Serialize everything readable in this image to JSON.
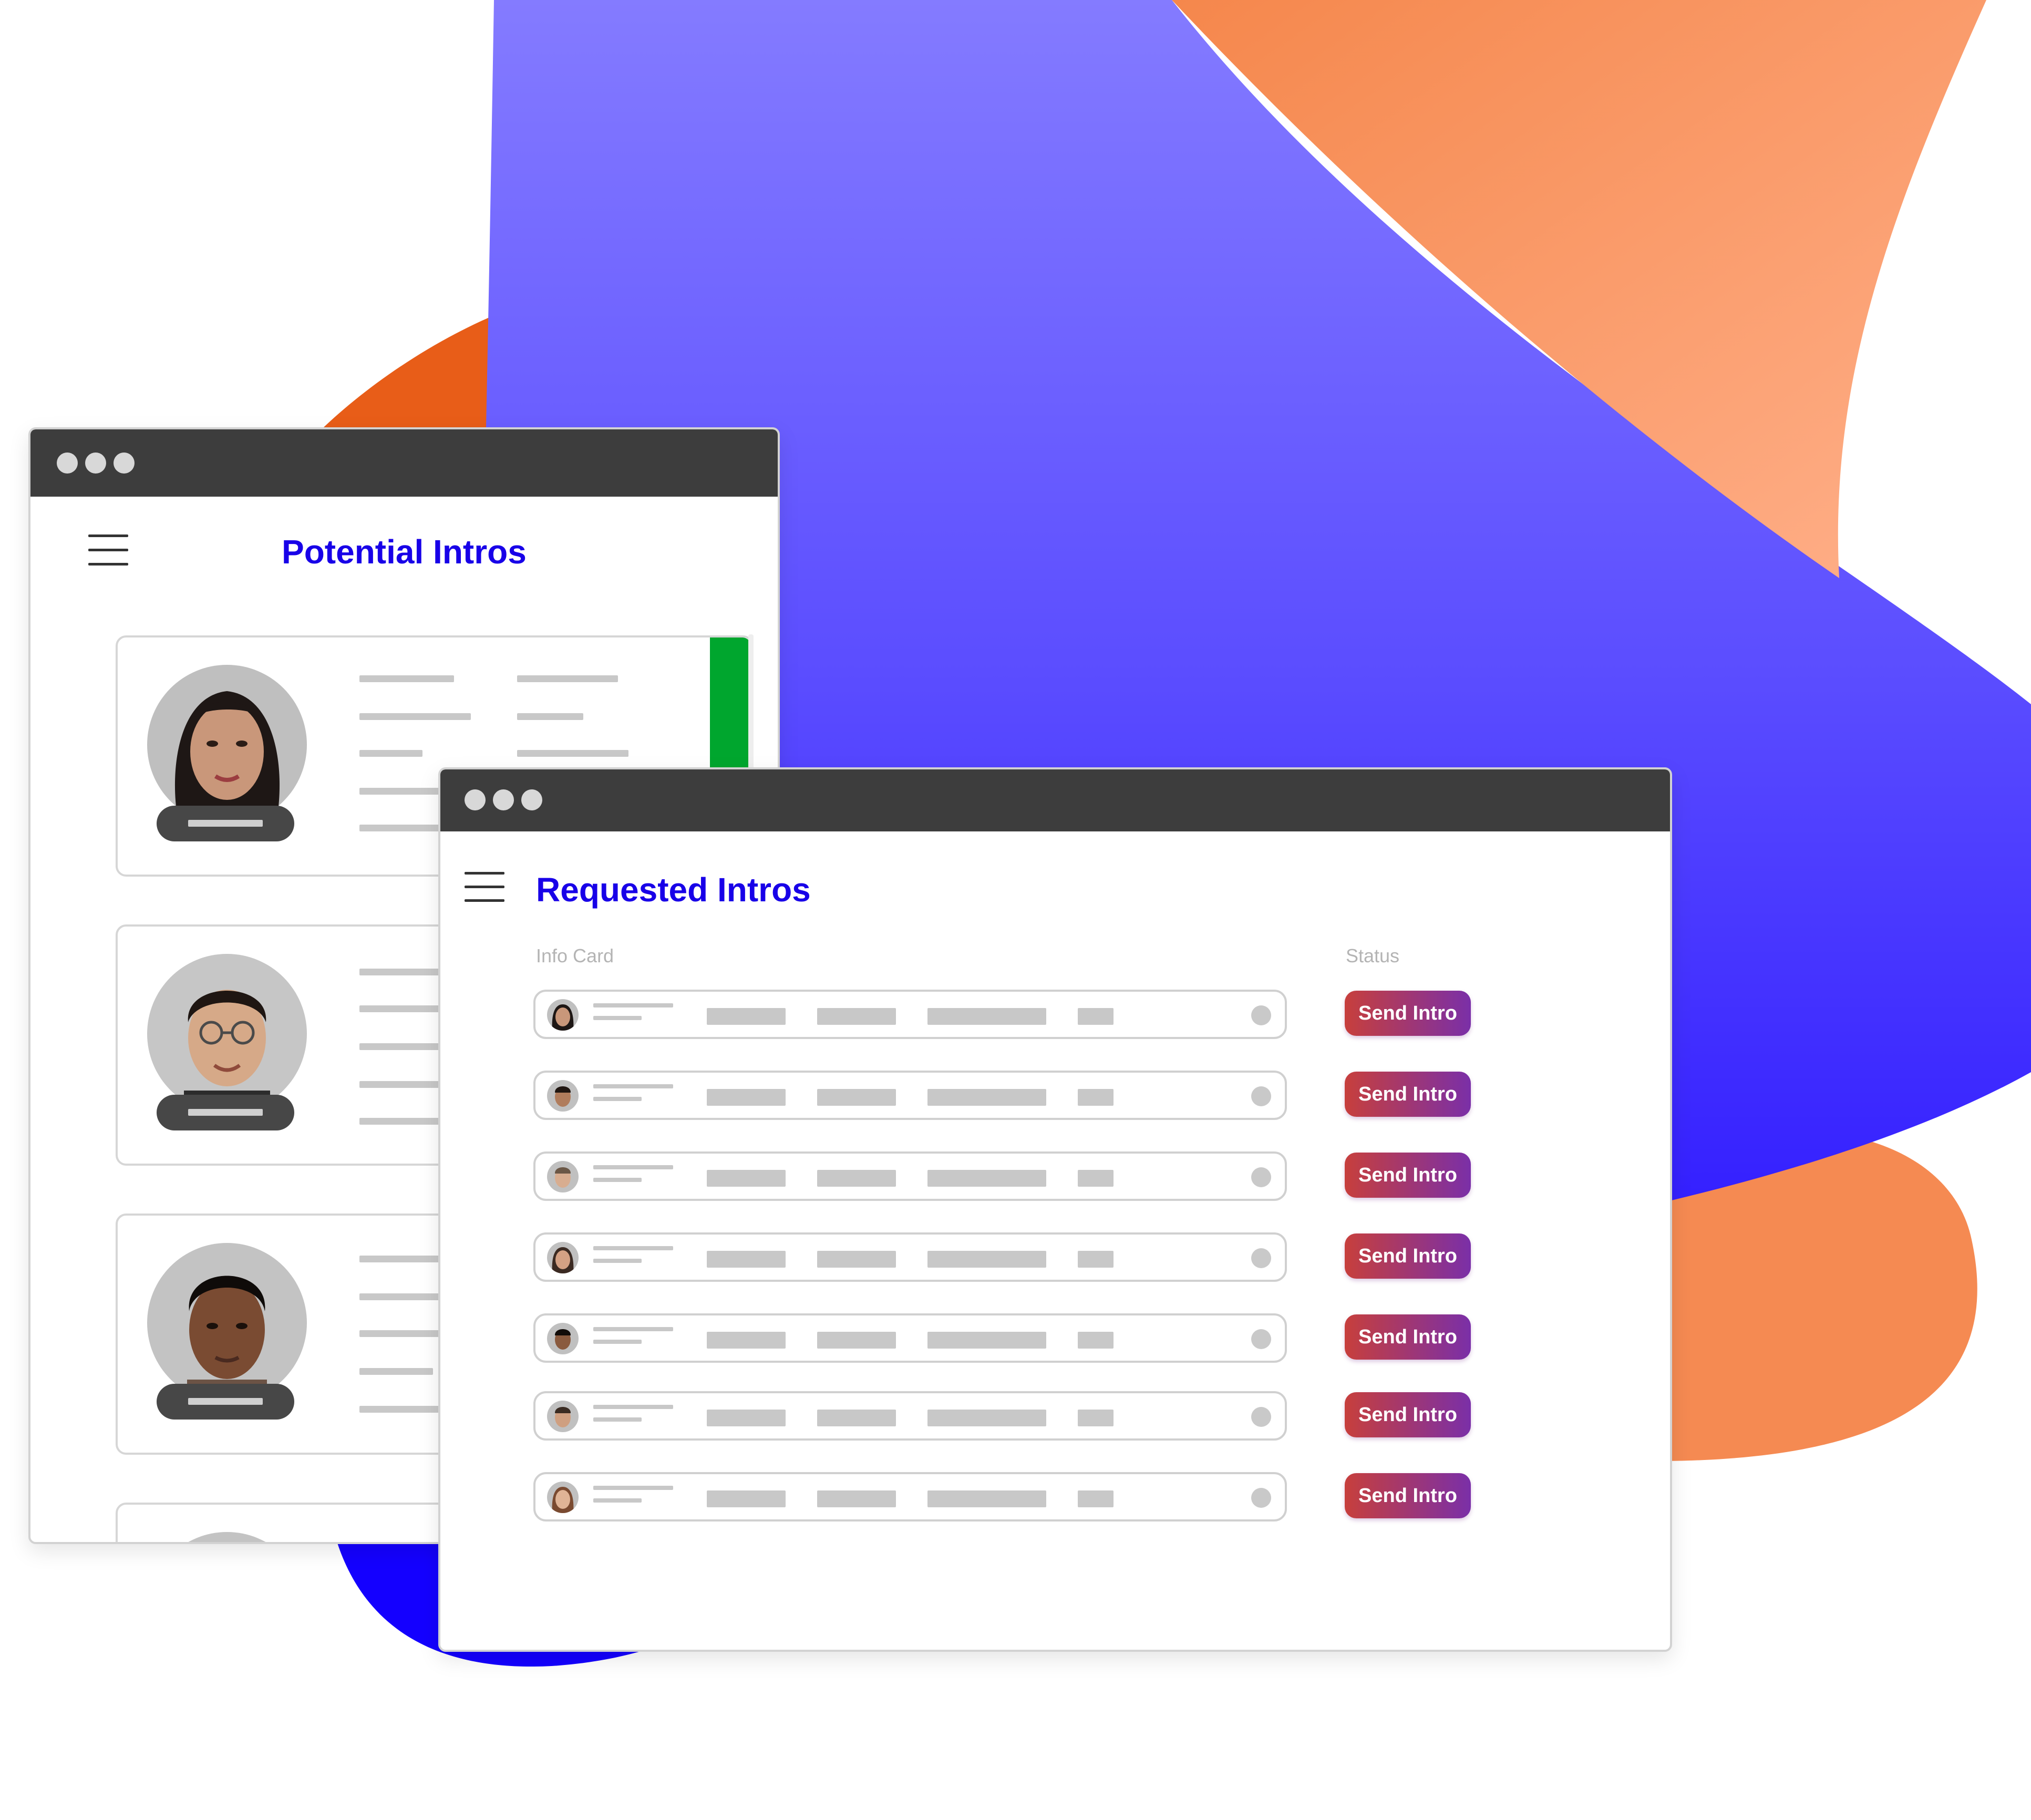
{
  "potential_window": {
    "title": "Potential Intros",
    "accent_color": "#00a62e",
    "cards": [
      {
        "avatar": "woman-portrait"
      },
      {
        "avatar": "man-with-glasses-portrait"
      },
      {
        "avatar": "woman-short-hair-portrait"
      },
      {
        "avatar": "partial-portrait"
      }
    ]
  },
  "requested_window": {
    "title": "Requested Intros",
    "columns": {
      "info_card": "Info Card",
      "status": "Status"
    },
    "rows": [
      {
        "avatar": "woman-avatar",
        "action": "Send Intro"
      },
      {
        "avatar": "man-avatar",
        "action": "Send Intro"
      },
      {
        "avatar": "man-avatar",
        "action": "Send Intro"
      },
      {
        "avatar": "woman-avatar",
        "action": "Send Intro"
      },
      {
        "avatar": "man-avatar",
        "action": "Send Intro"
      },
      {
        "avatar": "man-avatar",
        "action": "Send Intro"
      },
      {
        "avatar": "woman-avatar",
        "action": "Send Intro"
      }
    ]
  },
  "colors": {
    "title_blue": "#1800e8",
    "titlebar": "#3d3d3d",
    "blob_purple": "#5b4dff",
    "blob_orange": "#f58a52",
    "blob_dark_orange": "#e85d18",
    "button_gradient_start": "#c73f3c",
    "button_gradient_end": "#7a2fa8"
  }
}
